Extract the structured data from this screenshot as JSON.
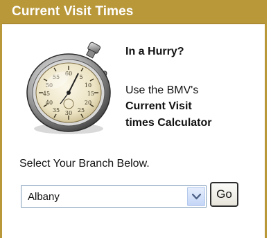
{
  "header": {
    "title": "Current Visit Times"
  },
  "promo": {
    "image_icon": "stopwatch-icon",
    "heading": "In a Hurry?",
    "body_line": "Use the BMV's",
    "calculator_line1": "Current Visit",
    "calculator_line2": "times Calculator"
  },
  "branch_form": {
    "label": "Select Your Branch Below.",
    "selected_branch": "Albany",
    "go_label": "Go"
  },
  "colors": {
    "header_bg": "#b9983a",
    "header_text": "#ffffff",
    "select_border": "#7f9db9",
    "arrow_button": "#c4d5f6"
  }
}
